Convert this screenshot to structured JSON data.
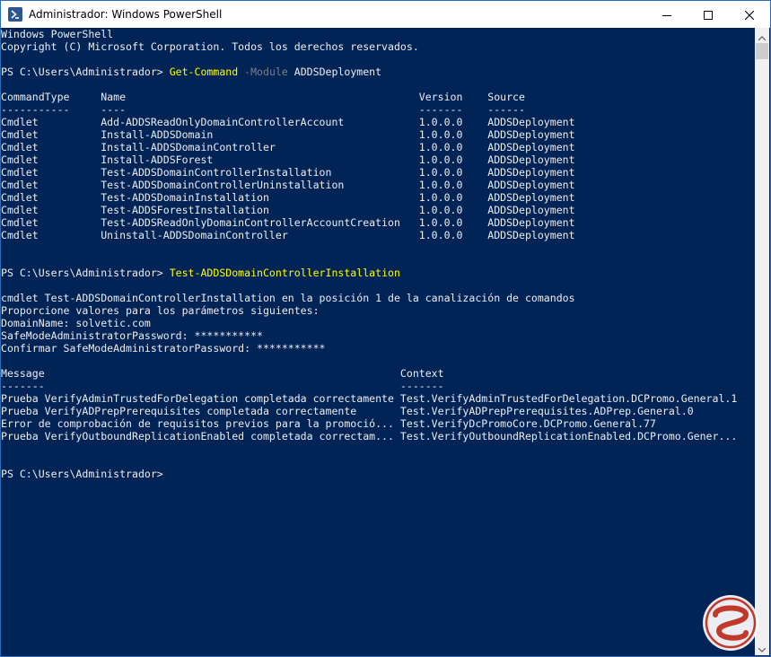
{
  "window": {
    "title": "Administrador: Windows PowerShell",
    "icon": "powershell-icon"
  },
  "controls": {
    "minimize": "minimize-icon",
    "maximize": "maximize-icon",
    "close": "close-icon"
  },
  "console": {
    "header": [
      "Windows PowerShell",
      "Copyright (C) Microsoft Corporation. Todos los derechos reservados."
    ],
    "prompt": "PS C:\\Users\\Administrador> ",
    "command1": {
      "cmd": "Get-Command",
      "param": "-Module",
      "arg": "ADDSDeployment"
    },
    "table1_headers": [
      "CommandType",
      "Name",
      "Version",
      "Source"
    ],
    "table1_underline": [
      "-----------",
      "----",
      "-------",
      "------"
    ],
    "table1_rows": [
      [
        "Cmdlet",
        "Add-ADDSReadOnlyDomainControllerAccount",
        "1.0.0.0",
        "ADDSDeployment"
      ],
      [
        "Cmdlet",
        "Install-ADDSDomain",
        "1.0.0.0",
        "ADDSDeployment"
      ],
      [
        "Cmdlet",
        "Install-ADDSDomainController",
        "1.0.0.0",
        "ADDSDeployment"
      ],
      [
        "Cmdlet",
        "Install-ADDSForest",
        "1.0.0.0",
        "ADDSDeployment"
      ],
      [
        "Cmdlet",
        "Test-ADDSDomainControllerInstallation",
        "1.0.0.0",
        "ADDSDeployment"
      ],
      [
        "Cmdlet",
        "Test-ADDSDomainControllerUninstallation",
        "1.0.0.0",
        "ADDSDeployment"
      ],
      [
        "Cmdlet",
        "Test-ADDSDomainInstallation",
        "1.0.0.0",
        "ADDSDeployment"
      ],
      [
        "Cmdlet",
        "Test-ADDSForestInstallation",
        "1.0.0.0",
        "ADDSDeployment"
      ],
      [
        "Cmdlet",
        "Test-ADDSReadOnlyDomainControllerAccountCreation",
        "1.0.0.0",
        "ADDSDeployment"
      ],
      [
        "Cmdlet",
        "Uninstall-ADDSDomainController",
        "1.0.0.0",
        "ADDSDeployment"
      ]
    ],
    "command2": "Test-ADDSDomainControllerInstallation",
    "params_lines": [
      "cmdlet Test-ADDSDomainControllerInstallation en la posición 1 de la canalización de comandos",
      "Proporcione valores para los parámetros siguientes:",
      "DomainName: solvetic.com",
      "SafeModeAdministratorPassword: ***********",
      "Confirmar SafeModeAdministratorPassword: ***********"
    ],
    "table2_headers": [
      "Message",
      "Context"
    ],
    "table2_underline": [
      "-------",
      "-------"
    ],
    "table2_rows": [
      [
        "Prueba VerifyAdminTrustedForDelegation completada correctamente",
        "Test.VerifyAdminTrustedForDelegation.DCPromo.General.1"
      ],
      [
        "Prueba VerifyADPrepPrerequisites completada correctamente",
        "Test.VerifyADPrepPrerequisites.ADPrep.General.0"
      ],
      [
        "Error de comprobación de requisitos previos para la promoció...",
        "Test.VerifyDcPromoCore.DCPromo.General.77"
      ],
      [
        "Prueba VerifyOutboundReplicationEnabled completada correctam...",
        "Test.VerifyOutboundReplicationEnabled.DCPromo.Gener..."
      ]
    ],
    "final_prompt": "PS C:\\Users\\Administrador>"
  },
  "colors": {
    "background": "#012456",
    "text": "#eeedf0",
    "command": "#ffff00",
    "parameter": "#7f7f7f"
  }
}
